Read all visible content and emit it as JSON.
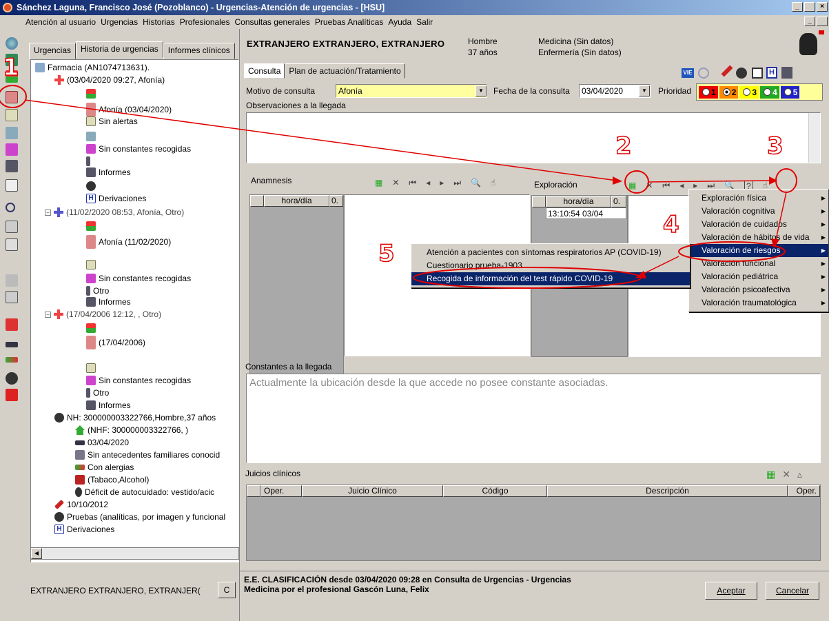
{
  "window": {
    "title": "Sánchez Laguna, Francisco José (Pozoblanco) - Urgencias-Atención de urgencias - [HSU]",
    "min": "_",
    "max": " ",
    "close": "×"
  },
  "menu": [
    "Atención al usuario",
    "Urgencias",
    "Historias",
    "Profesionales",
    "Consultas generales",
    "Pruebas Analíticas",
    "Ayuda",
    "Salir"
  ],
  "left_tabs": [
    "Urgencias",
    "Historia de urgencias",
    "Informes clínicos"
  ],
  "tree": [
    {
      "label": "Farmacia (AN1074713631)."
    },
    {
      "label": "(03/04/2020 09:27, Afonía)"
    },
    {
      "label": "Afonía (03/04/2020)"
    },
    {
      "label": "Sin alertas"
    },
    {
      "label": "Sin constantes recogidas"
    },
    {
      "label": "Informes"
    },
    {
      "label": "Derivaciones"
    },
    {
      "label": "(11/02/2020 08:53, Afonía, Otro)"
    },
    {
      "label": "Afonía (11/02/2020)"
    },
    {
      "label": "Sin constantes recogidas"
    },
    {
      "label": "Otro"
    },
    {
      "label": "Informes"
    },
    {
      "label": "(17/04/2006 12:12, , Otro)"
    },
    {
      "label": "(17/04/2006)"
    },
    {
      "label": "Sin constantes recogidas"
    },
    {
      "label": "Otro"
    },
    {
      "label": "Informes"
    },
    {
      "label": "NH: 300000003322766,Hombre,37 años"
    },
    {
      "label": "(NHF: 300000003322766, )"
    },
    {
      "label": "03/04/2020"
    },
    {
      "label": "Sin antecedentes familiares conocid"
    },
    {
      "label": "Con alergias"
    },
    {
      "label": "(Tabaco,Alcohol)"
    },
    {
      "label": "Déficit de autocuidado: vestido/acic"
    },
    {
      "label": "10/10/2012"
    },
    {
      "label": "Pruebas (analíticas, por imagen y funcional"
    },
    {
      "label": "Derivaciones"
    }
  ],
  "left_footer": {
    "patient": "EXTRANJERO EXTRANJERO, EXTRANJER(",
    "btn": "C"
  },
  "header": {
    "name": "EXTRANJERO EXTRANJERO, EXTRANJERO",
    "sex": "Hombre",
    "age": "37 años",
    "medicina": "Medicina (Sin datos)",
    "enfermeria": "Enfermería (Sin datos)"
  },
  "tabs": [
    "Consulta",
    "Plan de actuación/Tratamiento"
  ],
  "form": {
    "motivo_label": "Motivo de consulta",
    "motivo_value": "Afonía",
    "fecha_label": "Fecha de la consulta",
    "fecha_value": "03/04/2020",
    "prioridad_label": "Prioridad",
    "prioridades": [
      "1",
      "2",
      "3",
      "4",
      "5"
    ],
    "observaciones_label": "Observaciones a la llegada"
  },
  "anamnesis": {
    "label": "Anamnesis",
    "col_time": "hora/día",
    "col_o": "0."
  },
  "exploracion": {
    "label": "Exploración",
    "col_time": "hora/día",
    "col_o": "0.",
    "row_time": "13:10:54 03/04"
  },
  "context_menu": {
    "items": [
      "Exploración física",
      "Valoración cognitiva",
      "Valoración de cuidados",
      "Valoración de hábitos de vida",
      "Valoración de riesgos",
      "Valoración funcional",
      "Valoración pediátrica",
      "Valoración psicoafectiva",
      "Valoración traumatológica"
    ],
    "selected_index": 4
  },
  "submenu": {
    "items": [
      "Atención a pacientes con síntomas respiratorios AP (COVID-19)",
      "Cuestionario prueba-1903",
      "Recogida de información del test rápido COVID-19"
    ],
    "selected_index": 2
  },
  "constantes": {
    "label": "Constantes a la llegada",
    "placeholder": "Actualmente la ubicación desde la que accede no posee constante asociadas."
  },
  "juicios": {
    "label": "Juicios clínicos",
    "columns": [
      "Oper.",
      "Juicio Clínico",
      "Código",
      "Descripción",
      "Oper."
    ]
  },
  "status": {
    "line1": "E.E. CLASIFICACIÓN desde 03/04/2020 09:28 en Consulta de Urgencias - Urgencias",
    "line2": "Medicina por el profesional Gascón Luna, Felix"
  },
  "buttons": {
    "accept": "Aceptar",
    "cancel": "Cancelar"
  },
  "annotations": [
    "1",
    "2",
    "3",
    "4",
    "5"
  ],
  "icons": {
    "vie": "VIE",
    "h": "H"
  }
}
